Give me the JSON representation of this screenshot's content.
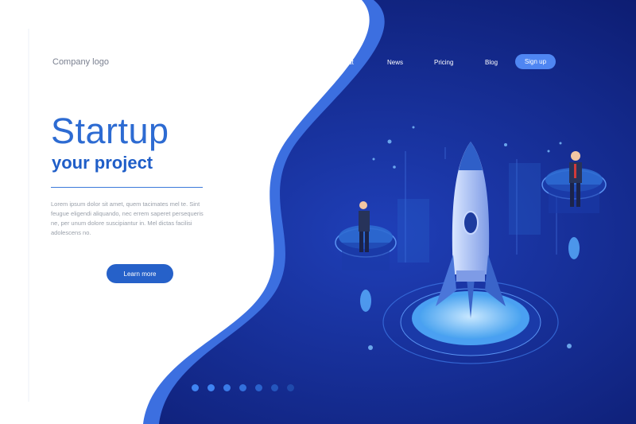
{
  "header": {
    "logo_text": "Company logo"
  },
  "nav": {
    "items": [
      {
        "label": "About"
      },
      {
        "label": "News"
      },
      {
        "label": "Pricing"
      },
      {
        "label": "Blog"
      }
    ],
    "signup_label": "Sign up"
  },
  "hero": {
    "title": "Startup",
    "subtitle": "your project",
    "body": "Lorem ipsum dolor sit amet, quem tacimates mel te. Sint feugue eligendi aliquando, nec errem saperet persequeris ne, per unum dolore suscipiantur in. Mel dictas facilisi adolescens no.",
    "cta_label": "Learn more"
  },
  "pager": {
    "count": 7,
    "active_index": 0
  },
  "colors": {
    "accent": "#2d6bd2",
    "dark_blue": "#0d1f7a",
    "button": "#2661c9",
    "signup": "#4f86f2"
  },
  "icons": [
    "rocket-icon",
    "businessman-icon"
  ]
}
